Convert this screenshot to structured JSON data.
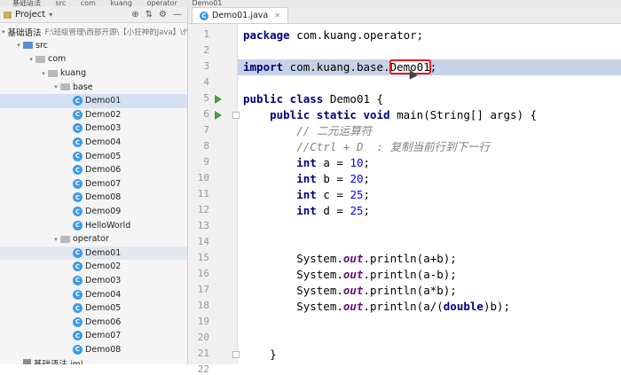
{
  "topbar": {
    "crumbs": [
      "基础语法",
      "src",
      "com",
      "kuang",
      "operator",
      "Demo01"
    ]
  },
  "project": {
    "title": "Project",
    "tree": [
      {
        "depth": 0,
        "twisty": "▾",
        "icon": "folder",
        "label": "基础语法",
        "path": "F:\\班级管理\\西部开源\\【小狂神的Java】\\代码\\JavaSE\\基础语法"
      },
      {
        "depth": 1,
        "twisty": "▾",
        "icon": "src",
        "label": "src"
      },
      {
        "depth": 2,
        "twisty": "▾",
        "icon": "pkg",
        "label": "com"
      },
      {
        "depth": 3,
        "twisty": "▾",
        "icon": "pkg",
        "label": "kuang"
      },
      {
        "depth": 4,
        "twisty": "▾",
        "icon": "pkg",
        "label": "base"
      },
      {
        "depth": 5,
        "twisty": "",
        "icon": "class",
        "label": "Demo01",
        "state": "selected"
      },
      {
        "depth": 5,
        "twisty": "",
        "icon": "class",
        "label": "Demo02"
      },
      {
        "depth": 5,
        "twisty": "",
        "icon": "class",
        "label": "Demo03"
      },
      {
        "depth": 5,
        "twisty": "",
        "icon": "class",
        "label": "Demo04"
      },
      {
        "depth": 5,
        "twisty": "",
        "icon": "class",
        "label": "Demo05"
      },
      {
        "depth": 5,
        "twisty": "",
        "icon": "class",
        "label": "Demo06"
      },
      {
        "depth": 5,
        "twisty": "",
        "icon": "class",
        "label": "Demo07"
      },
      {
        "depth": 5,
        "twisty": "",
        "icon": "class",
        "label": "Demo08"
      },
      {
        "depth": 5,
        "twisty": "",
        "icon": "class",
        "label": "Demo09"
      },
      {
        "depth": 5,
        "twisty": "",
        "icon": "class",
        "label": "HelloWorld"
      },
      {
        "depth": 4,
        "twisty": "▾",
        "icon": "pkg",
        "label": "operator"
      },
      {
        "depth": 5,
        "twisty": "",
        "icon": "class",
        "label": "Demo01",
        "state": "sel-op"
      },
      {
        "depth": 5,
        "twisty": "",
        "icon": "class",
        "label": "Demo02"
      },
      {
        "depth": 5,
        "twisty": "",
        "icon": "class",
        "label": "Demo03"
      },
      {
        "depth": 5,
        "twisty": "",
        "icon": "class",
        "label": "Demo04"
      },
      {
        "depth": 5,
        "twisty": "",
        "icon": "class",
        "label": "Demo05"
      },
      {
        "depth": 5,
        "twisty": "",
        "icon": "class",
        "label": "Demo06"
      },
      {
        "depth": 5,
        "twisty": "",
        "icon": "class",
        "label": "Demo07"
      },
      {
        "depth": 5,
        "twisty": "",
        "icon": "class",
        "label": "Demo08"
      },
      {
        "depth": 1,
        "twisty": "",
        "icon": "iml",
        "label": "基础语法.iml"
      }
    ]
  },
  "editor": {
    "tab_label": "Demo01.java",
    "class_icon_letter": "C",
    "lines": [
      {
        "n": "1",
        "tokens": [
          [
            "kw",
            "package"
          ],
          [
            "plain",
            " com.kuang.operator;"
          ]
        ]
      },
      {
        "n": "2",
        "tokens": []
      },
      {
        "n": "3",
        "highlight": true,
        "tokens": [
          [
            "kw",
            "import"
          ],
          [
            "plain",
            " com.kuang.base."
          ],
          [
            "boxed",
            "Demo01"
          ],
          [
            "plain",
            ";"
          ]
        ]
      },
      {
        "n": "4",
        "tokens": []
      },
      {
        "n": "5",
        "run": true,
        "tokens": [
          [
            "kw",
            "public class"
          ],
          [
            "plain",
            " Demo01 {"
          ]
        ]
      },
      {
        "n": "6",
        "run": true,
        "fold": true,
        "tokens": [
          [
            "plain",
            "    "
          ],
          [
            "kw",
            "public static void"
          ],
          [
            "plain",
            " main(String[] args) {"
          ]
        ]
      },
      {
        "n": "7",
        "tokens": [
          [
            "plain",
            "        "
          ],
          [
            "cm",
            "// 二元运算符"
          ]
        ]
      },
      {
        "n": "8",
        "tokens": [
          [
            "plain",
            "        "
          ],
          [
            "cm",
            "//Ctrl + D  : 复制当前行到下一行"
          ]
        ]
      },
      {
        "n": "9",
        "tokens": [
          [
            "plain",
            "        "
          ],
          [
            "kw",
            "int"
          ],
          [
            "plain",
            " a = "
          ],
          [
            "num",
            "10"
          ],
          [
            "plain",
            ";"
          ]
        ]
      },
      {
        "n": "10",
        "tokens": [
          [
            "plain",
            "        "
          ],
          [
            "kw",
            "int"
          ],
          [
            "plain",
            " b = "
          ],
          [
            "num",
            "20"
          ],
          [
            "plain",
            ";"
          ]
        ]
      },
      {
        "n": "11",
        "tokens": [
          [
            "plain",
            "        "
          ],
          [
            "kw",
            "int"
          ],
          [
            "plain",
            " c = "
          ],
          [
            "num",
            "25"
          ],
          [
            "plain",
            ";"
          ]
        ]
      },
      {
        "n": "12",
        "tokens": [
          [
            "plain",
            "        "
          ],
          [
            "kw",
            "int"
          ],
          [
            "plain",
            " d = "
          ],
          [
            "num",
            "25"
          ],
          [
            "plain",
            ";"
          ]
        ]
      },
      {
        "n": "13",
        "tokens": []
      },
      {
        "n": "14",
        "tokens": []
      },
      {
        "n": "15",
        "tokens": [
          [
            "plain",
            "        System."
          ],
          [
            "static",
            "out"
          ],
          [
            "plain",
            ".println(a+b);"
          ]
        ]
      },
      {
        "n": "16",
        "tokens": [
          [
            "plain",
            "        System."
          ],
          [
            "static",
            "out"
          ],
          [
            "plain",
            ".println(a-b);"
          ]
        ]
      },
      {
        "n": "17",
        "tokens": [
          [
            "plain",
            "        System."
          ],
          [
            "static",
            "out"
          ],
          [
            "plain",
            ".println(a*b);"
          ]
        ]
      },
      {
        "n": "18",
        "tokens": [
          [
            "plain",
            "        System."
          ],
          [
            "static",
            "out"
          ],
          [
            "plain",
            ".println(a/("
          ],
          [
            "kw",
            "double"
          ],
          [
            "plain",
            ")b);"
          ]
        ]
      },
      {
        "n": "19",
        "tokens": []
      },
      {
        "n": "20",
        "tokens": []
      },
      {
        "n": "21",
        "fold": true,
        "tokens": [
          [
            "plain",
            "    }"
          ]
        ]
      },
      {
        "n": "22",
        "tokens": [
          [
            "plain",
            "}"
          ]
        ]
      }
    ]
  }
}
